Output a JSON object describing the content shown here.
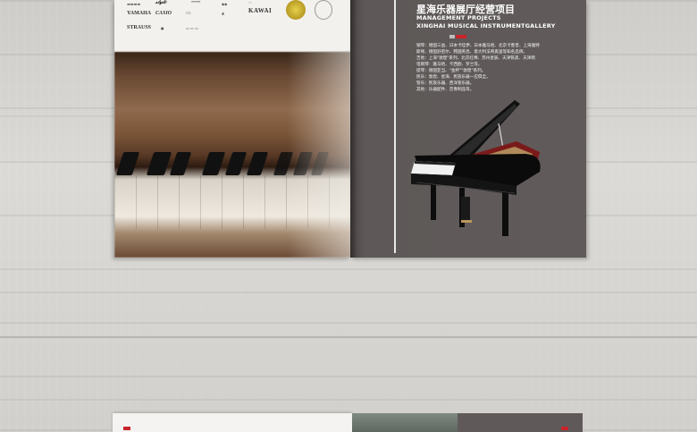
{
  "left_page": {
    "logos_row1": [
      "YAMAHA",
      "CASIO",
      "KAWAI"
    ],
    "logos_row2": [
      "STRAUSS"
    ]
  },
  "right_page": {
    "title_cn": "星海乐器展厅经营项目",
    "title_en_1": "MANAGEMENT PROJECTS",
    "title_en_2": "XINGHAI MUSICAL INSTRUMENTGALLERY",
    "body_lines": [
      "钢琴：德国三益、日本卡哇伊、日本雅马哈、北京卡鲁普、上海雅特",
      "斯顿、德国舒密尔、韩国英昌、意大利法奇奥里等知名品牌。",
      "吉他：上海\"敦煌\"系列、北京红棉、苏州星辰、天津铁黑、天津雨",
      "电钢琴：雅马哈、卡西欧、罗兰等。",
      "提琴：德国亚当、\"金杯\"\"敦煌\"系列。",
      "民乐：敦煌、星海、民族乐器一应俱全。",
      "管乐：民族乐器、西洋管乐器。",
      "其他：乐器配件、音像制品等。"
    ]
  },
  "accent_colors": {
    "red": "#c8242a",
    "dark_page": "#605b5a"
  }
}
